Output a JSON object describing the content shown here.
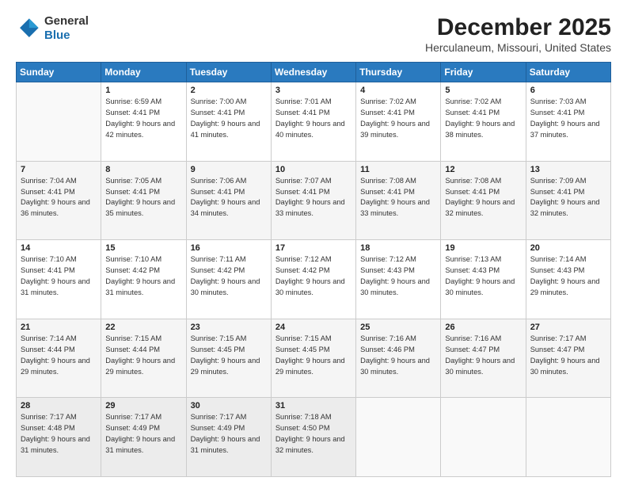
{
  "logo": {
    "general": "General",
    "blue": "Blue"
  },
  "header": {
    "title": "December 2025",
    "subtitle": "Herculaneum, Missouri, United States"
  },
  "weekdays": [
    "Sunday",
    "Monday",
    "Tuesday",
    "Wednesday",
    "Thursday",
    "Friday",
    "Saturday"
  ],
  "weeks": [
    [
      {
        "day": "",
        "sunrise": "",
        "sunset": "",
        "daylight": ""
      },
      {
        "day": "1",
        "sunrise": "Sunrise: 6:59 AM",
        "sunset": "Sunset: 4:41 PM",
        "daylight": "Daylight: 9 hours and 42 minutes."
      },
      {
        "day": "2",
        "sunrise": "Sunrise: 7:00 AM",
        "sunset": "Sunset: 4:41 PM",
        "daylight": "Daylight: 9 hours and 41 minutes."
      },
      {
        "day": "3",
        "sunrise": "Sunrise: 7:01 AM",
        "sunset": "Sunset: 4:41 PM",
        "daylight": "Daylight: 9 hours and 40 minutes."
      },
      {
        "day": "4",
        "sunrise": "Sunrise: 7:02 AM",
        "sunset": "Sunset: 4:41 PM",
        "daylight": "Daylight: 9 hours and 39 minutes."
      },
      {
        "day": "5",
        "sunrise": "Sunrise: 7:02 AM",
        "sunset": "Sunset: 4:41 PM",
        "daylight": "Daylight: 9 hours and 38 minutes."
      },
      {
        "day": "6",
        "sunrise": "Sunrise: 7:03 AM",
        "sunset": "Sunset: 4:41 PM",
        "daylight": "Daylight: 9 hours and 37 minutes."
      }
    ],
    [
      {
        "day": "7",
        "sunrise": "Sunrise: 7:04 AM",
        "sunset": "Sunset: 4:41 PM",
        "daylight": "Daylight: 9 hours and 36 minutes."
      },
      {
        "day": "8",
        "sunrise": "Sunrise: 7:05 AM",
        "sunset": "Sunset: 4:41 PM",
        "daylight": "Daylight: 9 hours and 35 minutes."
      },
      {
        "day": "9",
        "sunrise": "Sunrise: 7:06 AM",
        "sunset": "Sunset: 4:41 PM",
        "daylight": "Daylight: 9 hours and 34 minutes."
      },
      {
        "day": "10",
        "sunrise": "Sunrise: 7:07 AM",
        "sunset": "Sunset: 4:41 PM",
        "daylight": "Daylight: 9 hours and 33 minutes."
      },
      {
        "day": "11",
        "sunrise": "Sunrise: 7:08 AM",
        "sunset": "Sunset: 4:41 PM",
        "daylight": "Daylight: 9 hours and 33 minutes."
      },
      {
        "day": "12",
        "sunrise": "Sunrise: 7:08 AM",
        "sunset": "Sunset: 4:41 PM",
        "daylight": "Daylight: 9 hours and 32 minutes."
      },
      {
        "day": "13",
        "sunrise": "Sunrise: 7:09 AM",
        "sunset": "Sunset: 4:41 PM",
        "daylight": "Daylight: 9 hours and 32 minutes."
      }
    ],
    [
      {
        "day": "14",
        "sunrise": "Sunrise: 7:10 AM",
        "sunset": "Sunset: 4:41 PM",
        "daylight": "Daylight: 9 hours and 31 minutes."
      },
      {
        "day": "15",
        "sunrise": "Sunrise: 7:10 AM",
        "sunset": "Sunset: 4:42 PM",
        "daylight": "Daylight: 9 hours and 31 minutes."
      },
      {
        "day": "16",
        "sunrise": "Sunrise: 7:11 AM",
        "sunset": "Sunset: 4:42 PM",
        "daylight": "Daylight: 9 hours and 30 minutes."
      },
      {
        "day": "17",
        "sunrise": "Sunrise: 7:12 AM",
        "sunset": "Sunset: 4:42 PM",
        "daylight": "Daylight: 9 hours and 30 minutes."
      },
      {
        "day": "18",
        "sunrise": "Sunrise: 7:12 AM",
        "sunset": "Sunset: 4:43 PM",
        "daylight": "Daylight: 9 hours and 30 minutes."
      },
      {
        "day": "19",
        "sunrise": "Sunrise: 7:13 AM",
        "sunset": "Sunset: 4:43 PM",
        "daylight": "Daylight: 9 hours and 30 minutes."
      },
      {
        "day": "20",
        "sunrise": "Sunrise: 7:14 AM",
        "sunset": "Sunset: 4:43 PM",
        "daylight": "Daylight: 9 hours and 29 minutes."
      }
    ],
    [
      {
        "day": "21",
        "sunrise": "Sunrise: 7:14 AM",
        "sunset": "Sunset: 4:44 PM",
        "daylight": "Daylight: 9 hours and 29 minutes."
      },
      {
        "day": "22",
        "sunrise": "Sunrise: 7:15 AM",
        "sunset": "Sunset: 4:44 PM",
        "daylight": "Daylight: 9 hours and 29 minutes."
      },
      {
        "day": "23",
        "sunrise": "Sunrise: 7:15 AM",
        "sunset": "Sunset: 4:45 PM",
        "daylight": "Daylight: 9 hours and 29 minutes."
      },
      {
        "day": "24",
        "sunrise": "Sunrise: 7:15 AM",
        "sunset": "Sunset: 4:45 PM",
        "daylight": "Daylight: 9 hours and 29 minutes."
      },
      {
        "day": "25",
        "sunrise": "Sunrise: 7:16 AM",
        "sunset": "Sunset: 4:46 PM",
        "daylight": "Daylight: 9 hours and 30 minutes."
      },
      {
        "day": "26",
        "sunrise": "Sunrise: 7:16 AM",
        "sunset": "Sunset: 4:47 PM",
        "daylight": "Daylight: 9 hours and 30 minutes."
      },
      {
        "day": "27",
        "sunrise": "Sunrise: 7:17 AM",
        "sunset": "Sunset: 4:47 PM",
        "daylight": "Daylight: 9 hours and 30 minutes."
      }
    ],
    [
      {
        "day": "28",
        "sunrise": "Sunrise: 7:17 AM",
        "sunset": "Sunset: 4:48 PM",
        "daylight": "Daylight: 9 hours and 31 minutes."
      },
      {
        "day": "29",
        "sunrise": "Sunrise: 7:17 AM",
        "sunset": "Sunset: 4:49 PM",
        "daylight": "Daylight: 9 hours and 31 minutes."
      },
      {
        "day": "30",
        "sunrise": "Sunrise: 7:17 AM",
        "sunset": "Sunset: 4:49 PM",
        "daylight": "Daylight: 9 hours and 31 minutes."
      },
      {
        "day": "31",
        "sunrise": "Sunrise: 7:18 AM",
        "sunset": "Sunset: 4:50 PM",
        "daylight": "Daylight: 9 hours and 32 minutes."
      },
      {
        "day": "",
        "sunrise": "",
        "sunset": "",
        "daylight": ""
      },
      {
        "day": "",
        "sunrise": "",
        "sunset": "",
        "daylight": ""
      },
      {
        "day": "",
        "sunrise": "",
        "sunset": "",
        "daylight": ""
      }
    ]
  ]
}
